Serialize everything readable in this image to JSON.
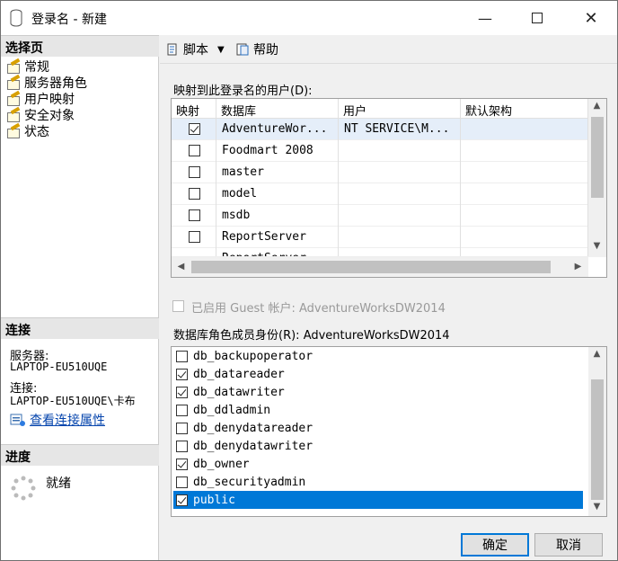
{
  "window": {
    "title": "登录名 - 新建"
  },
  "left": {
    "select_page_header": "选择页",
    "nav": [
      "常规",
      "服务器角色",
      "用户映射",
      "安全对象",
      "状态"
    ],
    "connection_header": "连接",
    "server_label": "服务器:",
    "server_value": "LAPTOP-EU510UQE",
    "connection_label": "连接:",
    "connection_value": "LAPTOP-EU510UQE\\卡布",
    "view_props_link": "查看连接属性",
    "progress_header": "进度",
    "progress_status": "就绪"
  },
  "toolbar": {
    "script_label": "脚本",
    "help_label": "帮助"
  },
  "mapping": {
    "label": "映射到此登录名的用户(D):",
    "headers": [
      "映射",
      "数据库",
      "用户",
      "默认架构"
    ],
    "rows": [
      {
        "checked": true,
        "db": "AdventureWor...",
        "user": "NT SERVICE\\M...",
        "schema": ""
      },
      {
        "checked": false,
        "db": "Foodmart 2008",
        "user": "",
        "schema": ""
      },
      {
        "checked": false,
        "db": "master",
        "user": "",
        "schema": ""
      },
      {
        "checked": false,
        "db": "model",
        "user": "",
        "schema": ""
      },
      {
        "checked": false,
        "db": "msdb",
        "user": "",
        "schema": ""
      },
      {
        "checked": false,
        "db": "ReportServer",
        "user": "",
        "schema": ""
      },
      {
        "checked": false,
        "db": "ReportServer",
        "user": "",
        "schema": ""
      }
    ]
  },
  "guest_label": "已启用 Guest 帐户: AdventureWorksDW2014",
  "roles": {
    "label": "数据库角色成员身份(R): AdventureWorksDW2014",
    "items": [
      {
        "name": "db_backupoperator",
        "checked": false,
        "selected": false
      },
      {
        "name": "db_datareader",
        "checked": true,
        "selected": false
      },
      {
        "name": "db_datawriter",
        "checked": true,
        "selected": false
      },
      {
        "name": "db_ddladmin",
        "checked": false,
        "selected": false
      },
      {
        "name": "db_denydatareader",
        "checked": false,
        "selected": false
      },
      {
        "name": "db_denydatawriter",
        "checked": false,
        "selected": false
      },
      {
        "name": "db_owner",
        "checked": true,
        "selected": false
      },
      {
        "name": "db_securityadmin",
        "checked": false,
        "selected": false
      },
      {
        "name": "public",
        "checked": true,
        "selected": true
      }
    ]
  },
  "buttons": {
    "ok": "确定",
    "cancel": "取消"
  }
}
